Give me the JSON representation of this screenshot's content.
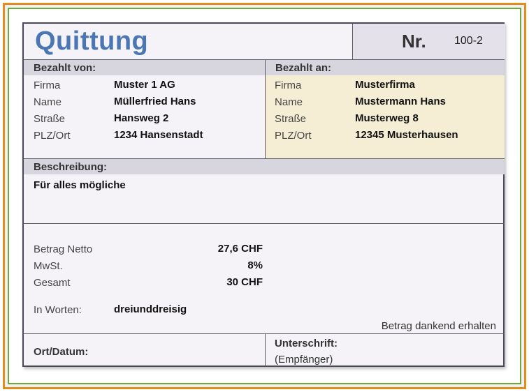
{
  "receipt": {
    "title": "Quittung",
    "number_label": "Nr.",
    "number_value": "100-2"
  },
  "payer": {
    "header": "Bezahlt von:",
    "rows": [
      {
        "label": "Firma",
        "value": "Muster 1 AG"
      },
      {
        "label": "Name",
        "value": "Müllerfried Hans"
      },
      {
        "label": "Straße",
        "value": "Hansweg 2"
      },
      {
        "label": "PLZ/Ort",
        "value": "1234 Hansenstadt"
      }
    ]
  },
  "payee": {
    "header": "Bezahlt an:",
    "rows": [
      {
        "label": "Firma",
        "value": "Musterfirma"
      },
      {
        "label": "Name",
        "value": "Mustermann Hans"
      },
      {
        "label": "Straße",
        "value": "Musterweg 8"
      },
      {
        "label": "PLZ/Ort",
        "value": "12345 Musterhausen"
      }
    ]
  },
  "description": {
    "header": "Beschreibung:",
    "text": "Für alles mögliche"
  },
  "amounts": {
    "net_label": "Betrag Netto",
    "net_value": "27,6 CHF",
    "vat_label": "MwSt.",
    "vat_value": "8%",
    "total_label": "Gesamt",
    "total_value": "30 CHF",
    "words_label": "In Worten:",
    "words_value": "dreiunddreisig",
    "received_note": "Betrag dankend erhalten"
  },
  "footer": {
    "place_date_label": "Ort/Datum:",
    "signature_label": "Unterschrift:",
    "signature_sub": "(Empfänger)"
  },
  "colors": {
    "frame_outer": "#e48c1c",
    "frame_inner": "#6fa83a",
    "title": "#4a76b4",
    "section_header": "#d7d5dd",
    "payee_background": "#f6eed4"
  }
}
